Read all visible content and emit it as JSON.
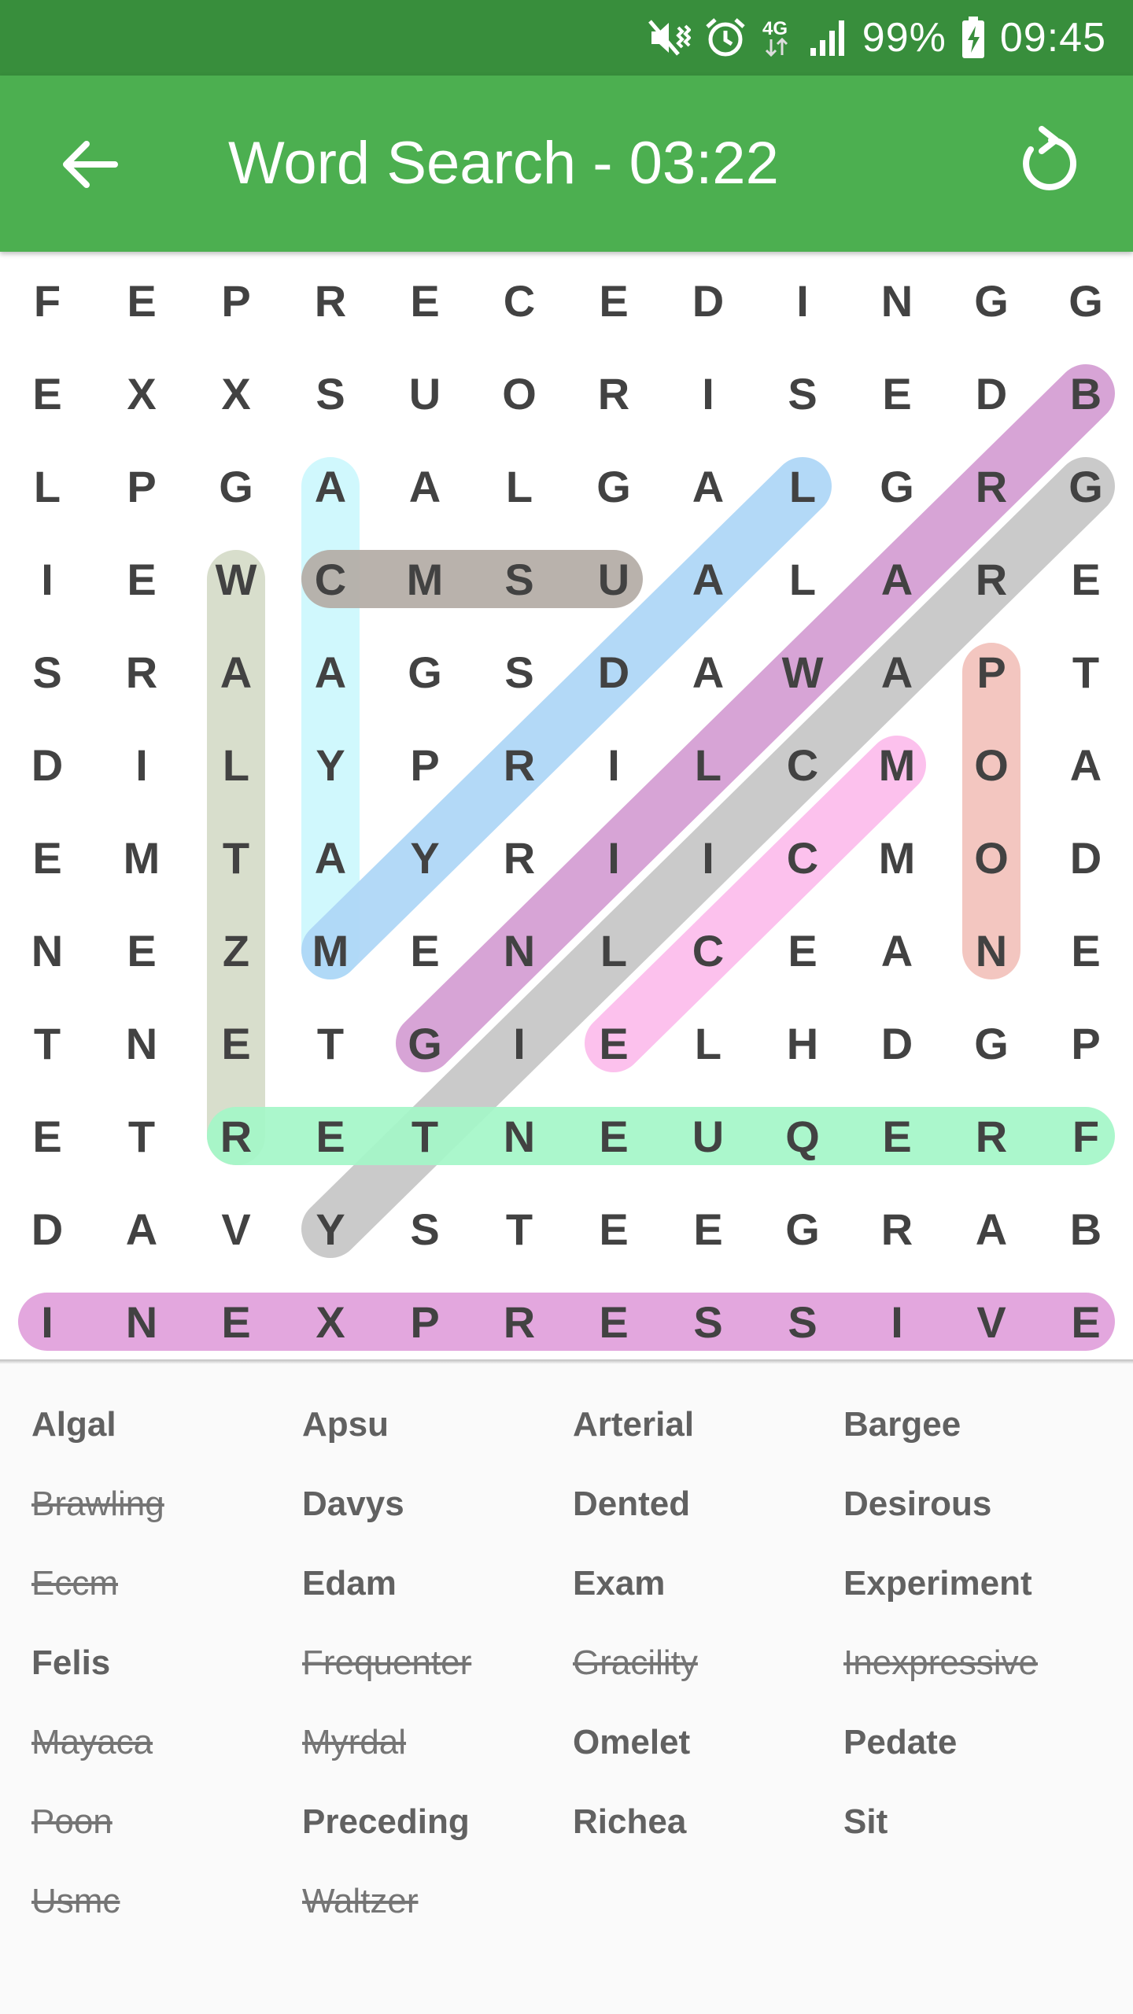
{
  "status_bar": {
    "battery_text": "99%",
    "time": "09:45",
    "network_label": "4G",
    "icons": [
      "mute-vibrate-icon",
      "alarm-icon",
      "network-4g-icon",
      "signal-icon",
      "battery-charging-icon"
    ]
  },
  "app_bar": {
    "title": "Word Search - 03:22",
    "back_icon": "arrow-back-icon",
    "restart_icon": "refresh-icon",
    "color": "#4caf50",
    "status_color": "#388e3c"
  },
  "grid": {
    "rows": [
      [
        "F",
        "E",
        "P",
        "R",
        "E",
        "C",
        "E",
        "D",
        "I",
        "N",
        "G",
        "G"
      ],
      [
        "E",
        "X",
        "X",
        "S",
        "U",
        "O",
        "R",
        "I",
        "S",
        "E",
        "D",
        "B"
      ],
      [
        "L",
        "P",
        "G",
        "A",
        "A",
        "L",
        "G",
        "A",
        "L",
        "G",
        "R",
        "G"
      ],
      [
        "I",
        "E",
        "W",
        "C",
        "M",
        "S",
        "U",
        "A",
        "L",
        "A",
        "R",
        "E"
      ],
      [
        "S",
        "R",
        "A",
        "A",
        "G",
        "S",
        "D",
        "A",
        "W",
        "A",
        "P",
        "T"
      ],
      [
        "D",
        "I",
        "L",
        "Y",
        "P",
        "R",
        "I",
        "L",
        "C",
        "M",
        "O",
        "A"
      ],
      [
        "E",
        "M",
        "T",
        "A",
        "Y",
        "R",
        "I",
        "I",
        "C",
        "M",
        "O",
        "D"
      ],
      [
        "N",
        "E",
        "Z",
        "M",
        "E",
        "N",
        "L",
        "C",
        "E",
        "A",
        "N",
        "E"
      ],
      [
        "T",
        "N",
        "E",
        "T",
        "G",
        "I",
        "E",
        "L",
        "H",
        "D",
        "G",
        "P"
      ],
      [
        "E",
        "T",
        "R",
        "E",
        "T",
        "N",
        "E",
        "U",
        "Q",
        "E",
        "R",
        "F"
      ],
      [
        "D",
        "A",
        "V",
        "Y",
        "S",
        "T",
        "E",
        "E",
        "G",
        "R",
        "A",
        "B"
      ],
      [
        "I",
        "N",
        "E",
        "X",
        "P",
        "R",
        "E",
        "S",
        "S",
        "I",
        "V",
        "E"
      ]
    ],
    "letter_color": "#424242",
    "highlights": [
      {
        "word": "Waltzer",
        "from": [
          3,
          2
        ],
        "to": [
          9,
          2
        ],
        "color": "#d5dbc8"
      },
      {
        "word": "Mayaca",
        "from": [
          7,
          3
        ],
        "to": [
          2,
          3
        ],
        "color": "#ccf7fd"
      },
      {
        "word": "Usmc",
        "from": [
          3,
          6
        ],
        "to": [
          3,
          3
        ],
        "color": "#b3aba5"
      },
      {
        "word": "Myrdal",
        "from": [
          7,
          3
        ],
        "to": [
          2,
          8
        ],
        "color": "#acd6f6"
      },
      {
        "word": "Brawling",
        "from": [
          1,
          11
        ],
        "to": [
          8,
          4
        ],
        "color": "#d49cd2"
      },
      {
        "word": "Gracility",
        "from": [
          2,
          11
        ],
        "to": [
          10,
          3
        ],
        "color": "#c6c6c6"
      },
      {
        "word": "Poon",
        "from": [
          4,
          10
        ],
        "to": [
          7,
          10
        ],
        "color": "#f2c1bb"
      },
      {
        "word": "Eccm",
        "from": [
          8,
          6
        ],
        "to": [
          5,
          9
        ],
        "color": "#fcbceb"
      },
      {
        "word": "Frequenter",
        "from": [
          9,
          11
        ],
        "to": [
          9,
          2
        ],
        "color": "#a4f6c8"
      },
      {
        "word": "Inexpressive",
        "from": [
          11,
          0
        ],
        "to": [
          11,
          11
        ],
        "color": "#e19fdb"
      }
    ]
  },
  "words": [
    {
      "label": "Algal",
      "found": false
    },
    {
      "label": "Apsu",
      "found": false
    },
    {
      "label": "Arterial",
      "found": false
    },
    {
      "label": "Bargee",
      "found": false
    },
    {
      "label": "Brawling",
      "found": true
    },
    {
      "label": "Davys",
      "found": false
    },
    {
      "label": "Dented",
      "found": false
    },
    {
      "label": "Desirous",
      "found": false
    },
    {
      "label": "Eccm",
      "found": true
    },
    {
      "label": "Edam",
      "found": false
    },
    {
      "label": "Exam",
      "found": false
    },
    {
      "label": "Experiment",
      "found": false
    },
    {
      "label": "Felis",
      "found": false
    },
    {
      "label": "Frequenter",
      "found": true
    },
    {
      "label": "Gracility",
      "found": true
    },
    {
      "label": "Inexpressive",
      "found": true
    },
    {
      "label": "Mayaca",
      "found": true
    },
    {
      "label": "Myrdal",
      "found": true
    },
    {
      "label": "Omelet",
      "found": false
    },
    {
      "label": "Pedate",
      "found": false
    },
    {
      "label": "Poon",
      "found": true
    },
    {
      "label": "Preceding",
      "found": false
    },
    {
      "label": "Richea",
      "found": false
    },
    {
      "label": "Sit",
      "found": false
    },
    {
      "label": "Usmc",
      "found": true
    },
    {
      "label": "Waltzer",
      "found": true
    }
  ]
}
